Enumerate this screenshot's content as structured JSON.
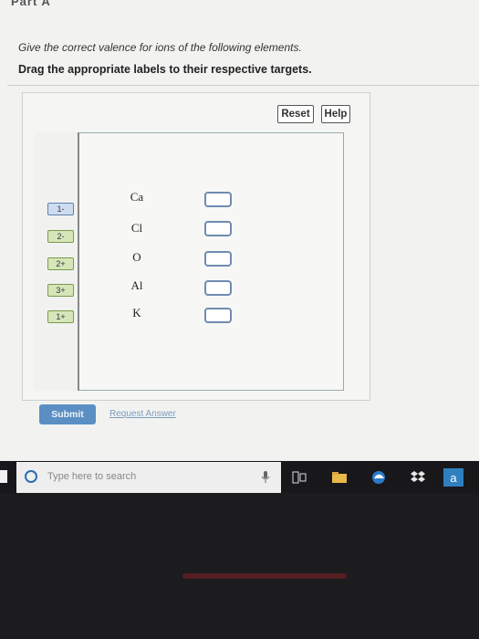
{
  "header": {
    "part_label": "Part A",
    "instruction": "Give the correct valence for ions of the following elements.",
    "drag_instruction": "Drag the appropriate labels to their respective targets."
  },
  "widget": {
    "reset_label": "Reset",
    "help_label": "Help",
    "labels": [
      "1-",
      "2-",
      "2+",
      "3+",
      "1+"
    ],
    "elements": [
      "Ca",
      "Cl",
      "O",
      "Al",
      "K"
    ]
  },
  "actions": {
    "submit_label": "Submit",
    "request_answer_label": "Request Answer"
  },
  "taskbar": {
    "search_placeholder": "Type here to search",
    "a_icon_label": "a"
  },
  "colors": {
    "accent": "#5a8fc4",
    "label_green": "#d7e6b8",
    "label_blue": "#cfdcef",
    "target_border": "#6f8cb0"
  }
}
